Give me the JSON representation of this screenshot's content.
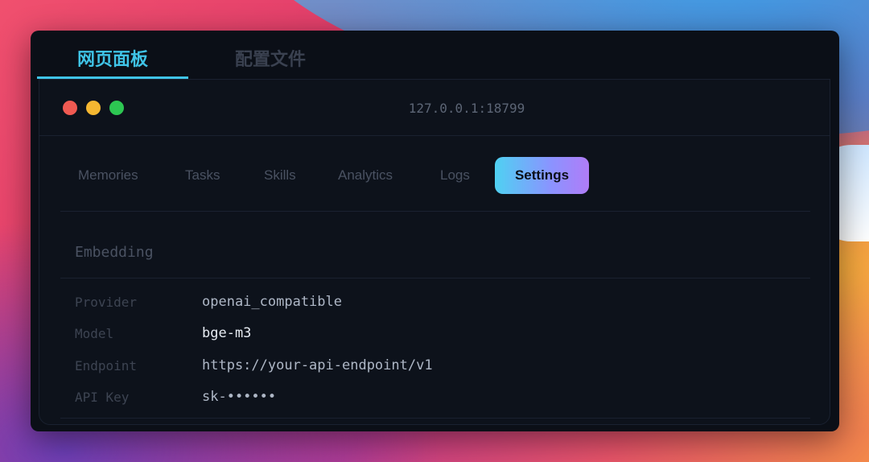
{
  "top_tabs": [
    {
      "label": "网页面板",
      "active": true
    },
    {
      "label": "配置文件",
      "active": false
    }
  ],
  "browser": {
    "address": "127.0.0.1:18799"
  },
  "nav": {
    "items": [
      {
        "label": "Memories",
        "active": false
      },
      {
        "label": "Tasks",
        "active": false
      },
      {
        "label": "Skills",
        "active": false
      },
      {
        "label": "Analytics",
        "active": false
      },
      {
        "label": "Logs",
        "active": false
      },
      {
        "label": "Settings",
        "active": true
      }
    ]
  },
  "settings": {
    "section_title": "Embedding",
    "rows": [
      {
        "label": "Provider",
        "value": "openai_compatible"
      },
      {
        "label": "Model",
        "value": "bge-m3"
      },
      {
        "label": "Endpoint",
        "value": "https://your-api-endpoint/v1"
      },
      {
        "label": "API Key",
        "value": "sk-••••••"
      }
    ]
  },
  "colors": {
    "accent": "#3fc3e6",
    "active_tab_gradient_start": "#4fd1f2",
    "active_tab_gradient_end": "#b07cf7",
    "window_bg": "#0b0f17"
  }
}
